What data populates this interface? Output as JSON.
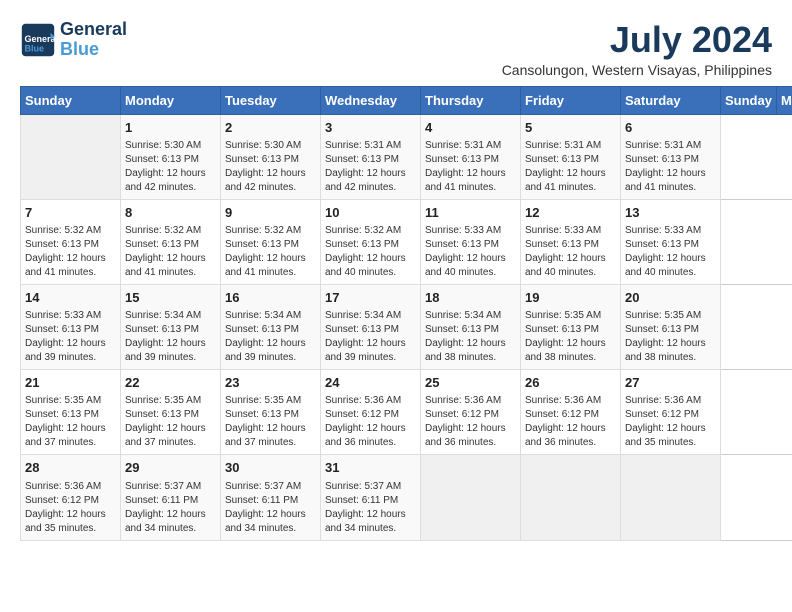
{
  "logo": {
    "text_general": "General",
    "text_blue": "Blue"
  },
  "header": {
    "month_year": "July 2024",
    "location": "Cansolungon, Western Visayas, Philippines"
  },
  "days_of_week": [
    "Sunday",
    "Monday",
    "Tuesday",
    "Wednesday",
    "Thursday",
    "Friday",
    "Saturday"
  ],
  "weeks": [
    [
      {
        "day": "",
        "sunrise": "",
        "sunset": "",
        "daylight": ""
      },
      {
        "day": "1",
        "sunrise": "Sunrise: 5:30 AM",
        "sunset": "Sunset: 6:13 PM",
        "daylight": "Daylight: 12 hours and 42 minutes."
      },
      {
        "day": "2",
        "sunrise": "Sunrise: 5:30 AM",
        "sunset": "Sunset: 6:13 PM",
        "daylight": "Daylight: 12 hours and 42 minutes."
      },
      {
        "day": "3",
        "sunrise": "Sunrise: 5:31 AM",
        "sunset": "Sunset: 6:13 PM",
        "daylight": "Daylight: 12 hours and 42 minutes."
      },
      {
        "day": "4",
        "sunrise": "Sunrise: 5:31 AM",
        "sunset": "Sunset: 6:13 PM",
        "daylight": "Daylight: 12 hours and 41 minutes."
      },
      {
        "day": "5",
        "sunrise": "Sunrise: 5:31 AM",
        "sunset": "Sunset: 6:13 PM",
        "daylight": "Daylight: 12 hours and 41 minutes."
      },
      {
        "day": "6",
        "sunrise": "Sunrise: 5:31 AM",
        "sunset": "Sunset: 6:13 PM",
        "daylight": "Daylight: 12 hours and 41 minutes."
      }
    ],
    [
      {
        "day": "7",
        "sunrise": "Sunrise: 5:32 AM",
        "sunset": "Sunset: 6:13 PM",
        "daylight": "Daylight: 12 hours and 41 minutes."
      },
      {
        "day": "8",
        "sunrise": "Sunrise: 5:32 AM",
        "sunset": "Sunset: 6:13 PM",
        "daylight": "Daylight: 12 hours and 41 minutes."
      },
      {
        "day": "9",
        "sunrise": "Sunrise: 5:32 AM",
        "sunset": "Sunset: 6:13 PM",
        "daylight": "Daylight: 12 hours and 41 minutes."
      },
      {
        "day": "10",
        "sunrise": "Sunrise: 5:32 AM",
        "sunset": "Sunset: 6:13 PM",
        "daylight": "Daylight: 12 hours and 40 minutes."
      },
      {
        "day": "11",
        "sunrise": "Sunrise: 5:33 AM",
        "sunset": "Sunset: 6:13 PM",
        "daylight": "Daylight: 12 hours and 40 minutes."
      },
      {
        "day": "12",
        "sunrise": "Sunrise: 5:33 AM",
        "sunset": "Sunset: 6:13 PM",
        "daylight": "Daylight: 12 hours and 40 minutes."
      },
      {
        "day": "13",
        "sunrise": "Sunrise: 5:33 AM",
        "sunset": "Sunset: 6:13 PM",
        "daylight": "Daylight: 12 hours and 40 minutes."
      }
    ],
    [
      {
        "day": "14",
        "sunrise": "Sunrise: 5:33 AM",
        "sunset": "Sunset: 6:13 PM",
        "daylight": "Daylight: 12 hours and 39 minutes."
      },
      {
        "day": "15",
        "sunrise": "Sunrise: 5:34 AM",
        "sunset": "Sunset: 6:13 PM",
        "daylight": "Daylight: 12 hours and 39 minutes."
      },
      {
        "day": "16",
        "sunrise": "Sunrise: 5:34 AM",
        "sunset": "Sunset: 6:13 PM",
        "daylight": "Daylight: 12 hours and 39 minutes."
      },
      {
        "day": "17",
        "sunrise": "Sunrise: 5:34 AM",
        "sunset": "Sunset: 6:13 PM",
        "daylight": "Daylight: 12 hours and 39 minutes."
      },
      {
        "day": "18",
        "sunrise": "Sunrise: 5:34 AM",
        "sunset": "Sunset: 6:13 PM",
        "daylight": "Daylight: 12 hours and 38 minutes."
      },
      {
        "day": "19",
        "sunrise": "Sunrise: 5:35 AM",
        "sunset": "Sunset: 6:13 PM",
        "daylight": "Daylight: 12 hours and 38 minutes."
      },
      {
        "day": "20",
        "sunrise": "Sunrise: 5:35 AM",
        "sunset": "Sunset: 6:13 PM",
        "daylight": "Daylight: 12 hours and 38 minutes."
      }
    ],
    [
      {
        "day": "21",
        "sunrise": "Sunrise: 5:35 AM",
        "sunset": "Sunset: 6:13 PM",
        "daylight": "Daylight: 12 hours and 37 minutes."
      },
      {
        "day": "22",
        "sunrise": "Sunrise: 5:35 AM",
        "sunset": "Sunset: 6:13 PM",
        "daylight": "Daylight: 12 hours and 37 minutes."
      },
      {
        "day": "23",
        "sunrise": "Sunrise: 5:35 AM",
        "sunset": "Sunset: 6:13 PM",
        "daylight": "Daylight: 12 hours and 37 minutes."
      },
      {
        "day": "24",
        "sunrise": "Sunrise: 5:36 AM",
        "sunset": "Sunset: 6:12 PM",
        "daylight": "Daylight: 12 hours and 36 minutes."
      },
      {
        "day": "25",
        "sunrise": "Sunrise: 5:36 AM",
        "sunset": "Sunset: 6:12 PM",
        "daylight": "Daylight: 12 hours and 36 minutes."
      },
      {
        "day": "26",
        "sunrise": "Sunrise: 5:36 AM",
        "sunset": "Sunset: 6:12 PM",
        "daylight": "Daylight: 12 hours and 36 minutes."
      },
      {
        "day": "27",
        "sunrise": "Sunrise: 5:36 AM",
        "sunset": "Sunset: 6:12 PM",
        "daylight": "Daylight: 12 hours and 35 minutes."
      }
    ],
    [
      {
        "day": "28",
        "sunrise": "Sunrise: 5:36 AM",
        "sunset": "Sunset: 6:12 PM",
        "daylight": "Daylight: 12 hours and 35 minutes."
      },
      {
        "day": "29",
        "sunrise": "Sunrise: 5:37 AM",
        "sunset": "Sunset: 6:11 PM",
        "daylight": "Daylight: 12 hours and 34 minutes."
      },
      {
        "day": "30",
        "sunrise": "Sunrise: 5:37 AM",
        "sunset": "Sunset: 6:11 PM",
        "daylight": "Daylight: 12 hours and 34 minutes."
      },
      {
        "day": "31",
        "sunrise": "Sunrise: 5:37 AM",
        "sunset": "Sunset: 6:11 PM",
        "daylight": "Daylight: 12 hours and 34 minutes."
      },
      {
        "day": "",
        "sunrise": "",
        "sunset": "",
        "daylight": ""
      },
      {
        "day": "",
        "sunrise": "",
        "sunset": "",
        "daylight": ""
      },
      {
        "day": "",
        "sunrise": "",
        "sunset": "",
        "daylight": ""
      }
    ]
  ]
}
